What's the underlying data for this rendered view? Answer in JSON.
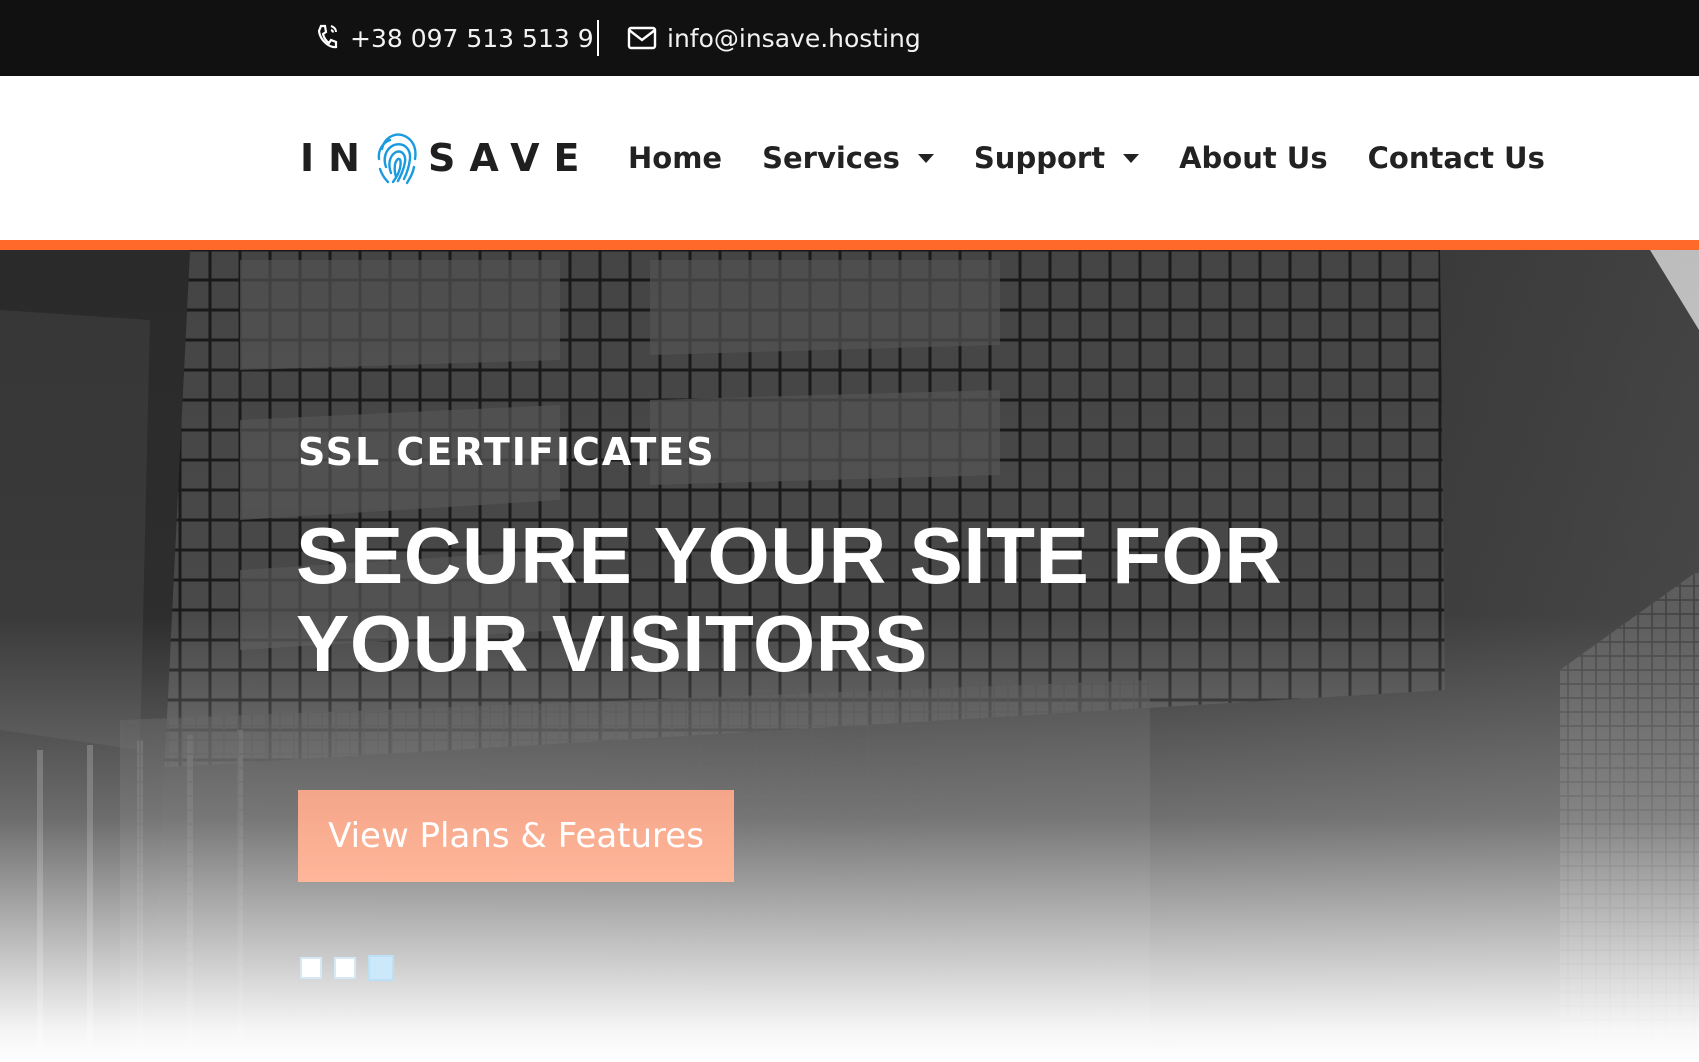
{
  "topbar": {
    "phone": "+38 097 513 513 9",
    "email": "info@insave.hosting"
  },
  "brand": {
    "logo_part1": "IN",
    "logo_part2": "SAVE",
    "accent_color": "#ff6a2b",
    "logo_blue": "#1a9be0"
  },
  "nav": {
    "home": "Home",
    "services": "Services",
    "support": "Support",
    "about": "About Us",
    "contact": "Contact Us"
  },
  "hero": {
    "kicker": "SSL CERTIFICATES",
    "headline": "SECURE YOUR SITE FOR YOUR VISITORS",
    "cta_label": "View Plans & Features",
    "slides_total": 3,
    "slide_active": 3
  },
  "icons": [
    "phone-icon",
    "envelope-icon",
    "fingerprint-icon",
    "caret-down-icon"
  ]
}
